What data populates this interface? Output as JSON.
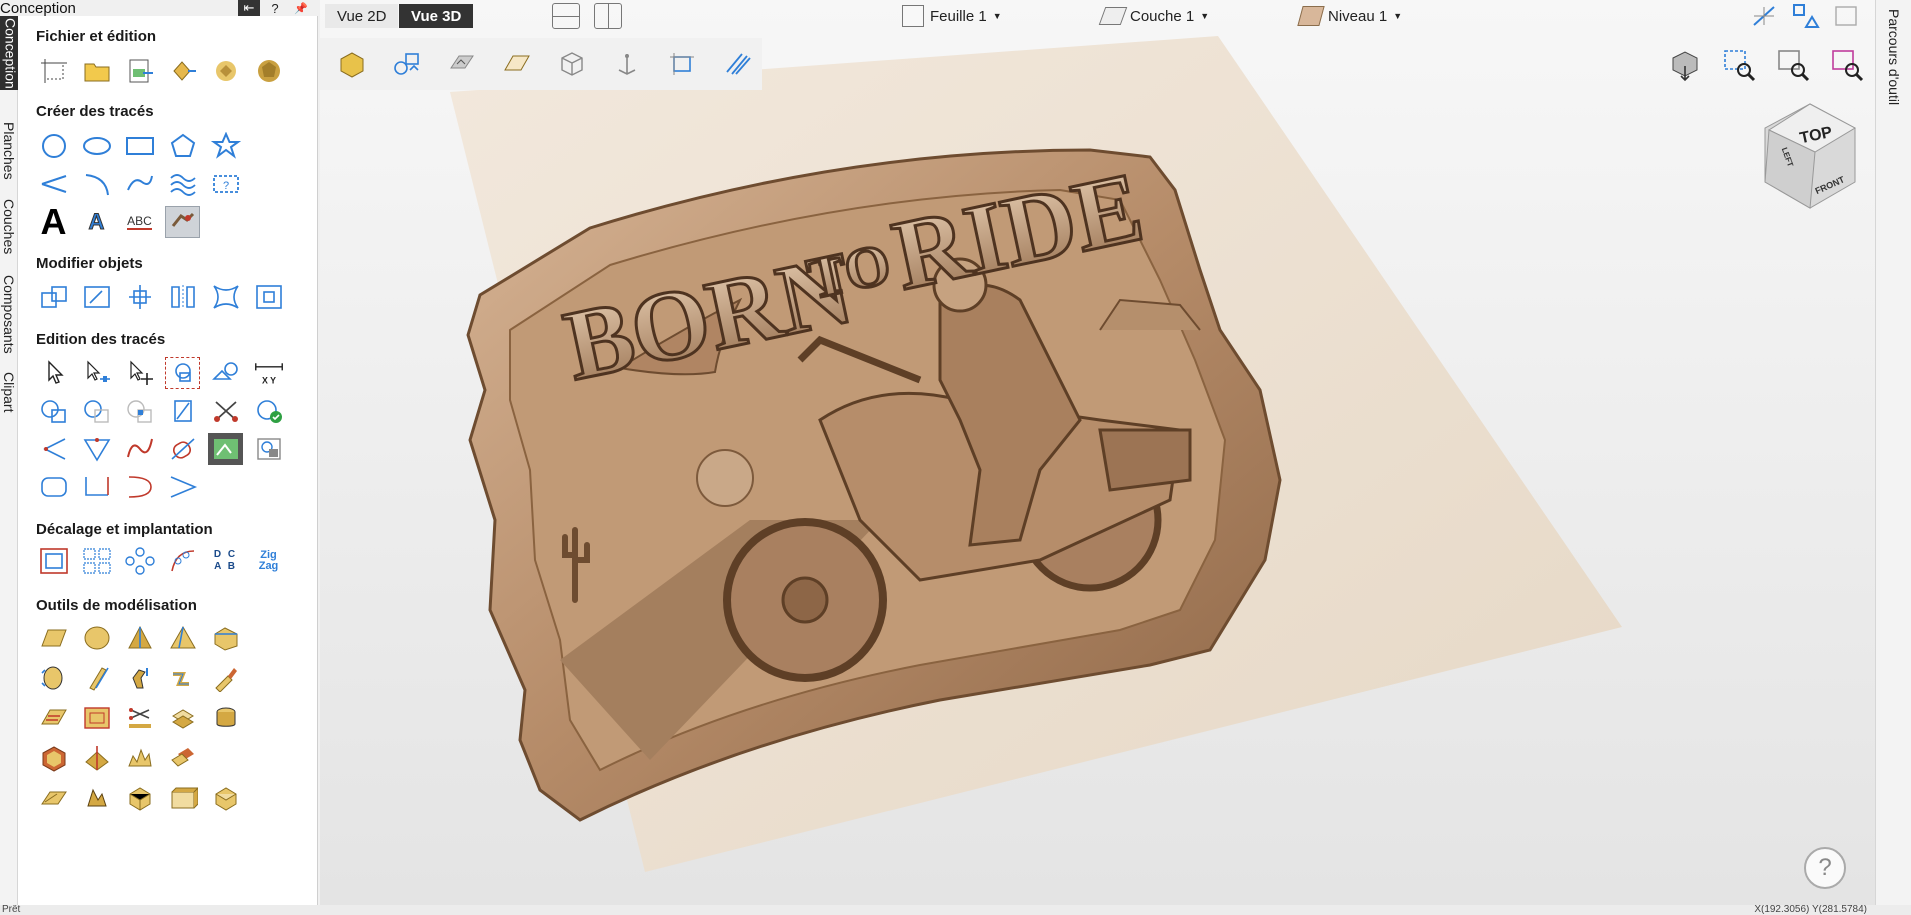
{
  "panel": {
    "title": "Conception",
    "header_buttons": [
      "⇤",
      "?",
      "📌"
    ],
    "sections": [
      {
        "title": "Fichier et édition"
      },
      {
        "title": "Créer des tracés"
      },
      {
        "title": "Modifier objets"
      },
      {
        "title": "Edition des tracés"
      },
      {
        "title": "Décalage et implantation"
      },
      {
        "title": "Outils de modélisation"
      }
    ],
    "text_icons": {
      "big_a": "A",
      "small_a": "A",
      "abc": "ABC",
      "xy": "X  Y",
      "dcab": "D C A B",
      "zigzag": "Zig Zag"
    }
  },
  "left_tabs": [
    "Conception",
    "Planches",
    "Couches",
    "Composants",
    "Clipart"
  ],
  "right_tabs": [
    "Parcours d'outil"
  ],
  "view": {
    "tab_2d": "Vue 2D",
    "tab_3d": "Vue 3D",
    "active": "Vue 3D"
  },
  "dropdowns": {
    "sheet": "Feuille 1",
    "layer": "Couche 1",
    "level": "Niveau 1"
  },
  "cube": {
    "top": "TOP",
    "left": "LEFT",
    "front": "FRONT"
  },
  "model": {
    "headline_1": "BORN",
    "headline_2": "TO",
    "headline_3": "RIDE"
  },
  "status": {
    "left": "Prêt",
    "right": "X(192.3056) Y(281.5784)"
  },
  "help": "?",
  "colors": {
    "accent": "#2f7fd8",
    "relief": "#b48a68",
    "dark_tab": "#2f2f2f"
  }
}
